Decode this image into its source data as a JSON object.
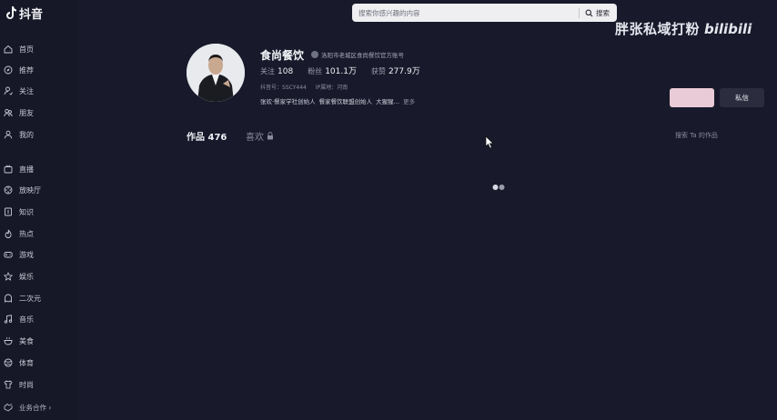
{
  "app": {
    "logo_text": "抖音"
  },
  "sidebar": {
    "items": [
      {
        "label": "首页",
        "icon": "home-icon"
      },
      {
        "label": "推荐",
        "icon": "compass-icon"
      },
      {
        "label": "关注",
        "icon": "user-follow-icon"
      },
      {
        "label": "朋友",
        "icon": "friends-icon"
      },
      {
        "label": "我的",
        "icon": "user-icon"
      },
      {
        "label": "直播",
        "icon": "live-tv-icon"
      },
      {
        "label": "放映厅",
        "icon": "cinema-icon"
      },
      {
        "label": "知识",
        "icon": "book-icon"
      },
      {
        "label": "热点",
        "icon": "flame-icon"
      },
      {
        "label": "游戏",
        "icon": "gamepad-icon"
      },
      {
        "label": "娱乐",
        "icon": "star-icon"
      },
      {
        "label": "二次元",
        "icon": "ghost-icon"
      },
      {
        "label": "音乐",
        "icon": "music-icon"
      },
      {
        "label": "美食",
        "icon": "food-icon"
      },
      {
        "label": "体育",
        "icon": "ball-icon"
      },
      {
        "label": "时尚",
        "icon": "shirt-icon"
      }
    ],
    "footer_label": "业务合作 ›"
  },
  "search": {
    "placeholder": "搜索你感兴趣的内容",
    "button_label": "搜索"
  },
  "watermark": {
    "text": "胖张私域打粉",
    "logo": "bilibili"
  },
  "profile": {
    "name": "食尚餐饮",
    "verification": "洛阳市老城区食尚餐饮官方账号",
    "stats": [
      {
        "label": "关注",
        "value": "108"
      },
      {
        "label": "粉丝",
        "value": "101.1万"
      },
      {
        "label": "获赞",
        "value": "277.9万"
      }
    ],
    "douyin_id_label": "抖音号：",
    "douyin_id": "SSCY444",
    "ip_label": "IP属地：",
    "ip_location": "河南",
    "bio_items": [
      "张欢·餐家学社创始人",
      "餐家餐饮联盟创始人",
      "大猩猩…"
    ],
    "more_label": "更多",
    "follow_label": "",
    "message_label": "私信"
  },
  "tabs": {
    "works_label": "作品",
    "works_count": "476",
    "likes_label": "喜欢",
    "search_works_label": "搜索 Ta 的作品"
  }
}
